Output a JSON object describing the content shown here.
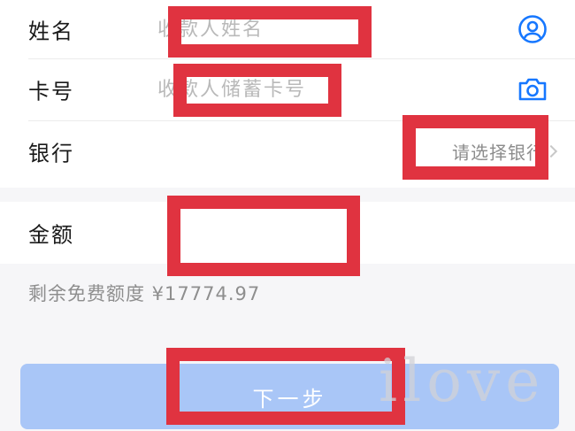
{
  "form": {
    "name": {
      "label": "姓名",
      "placeholder": "收款人姓名",
      "icon": "contact-icon"
    },
    "card": {
      "label": "卡号",
      "placeholder": "收款人储蓄卡号",
      "icon": "camera-icon"
    },
    "bank": {
      "label": "银行",
      "placeholder": "请选择银行"
    },
    "amount": {
      "label": "金额",
      "value": ""
    }
  },
  "quota": {
    "text": "剩余免费额度 ¥17774.97"
  },
  "submit": {
    "label": "下一步"
  },
  "watermark": {
    "text": "ilove"
  },
  "colors": {
    "accent": "#1677ff",
    "button_disabled": "#a9c6f7",
    "redaction": "#e03340",
    "background": "#f6f6f8"
  }
}
